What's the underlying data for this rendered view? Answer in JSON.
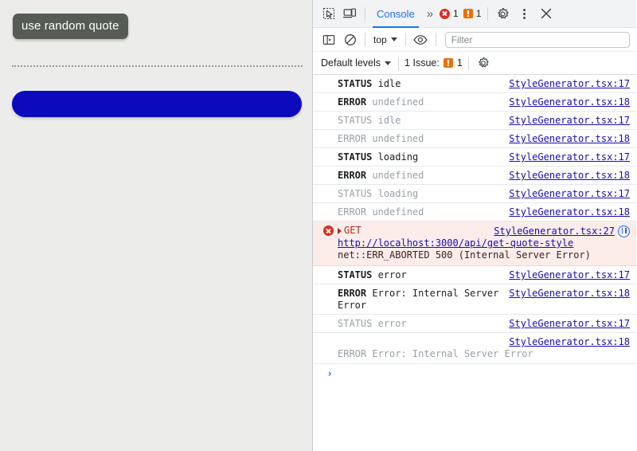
{
  "page": {
    "tooltip_label": "use random quote",
    "button_label": "",
    "button_color": "#0b0bbd",
    "background_color": "#ececeb",
    "tooltip_color": "#565b53"
  },
  "devtools": {
    "tabs": {
      "inspect_icon": "inspect-element-icon",
      "device_icon": "device-toolbar-icon",
      "active_tab": "Console",
      "more_tabs": "»",
      "error_count": "1",
      "warning_count": "1",
      "settings_icon": "gear-icon",
      "kebab_icon": "more-options-icon",
      "close_icon": "close-icon"
    },
    "toolbar": {
      "sidebar_icon": "console-sidebar-icon",
      "clear_icon": "clear-console-icon",
      "context": "top",
      "eye_icon": "live-expression-icon",
      "filter_placeholder": "Filter",
      "filter_value": ""
    },
    "levels": {
      "levels_label": "Default levels",
      "issues_label": "1 Issue:",
      "issues_count": "1",
      "issues_settings_icon": "gear-icon"
    },
    "messages": [
      {
        "kind": "log",
        "dimmed": false,
        "label": "STATUS",
        "value": "idle",
        "value_dim": false,
        "source": "StyleGenerator.tsx:17"
      },
      {
        "kind": "log",
        "dimmed": false,
        "label": "ERROR",
        "value": "undefined",
        "value_dim": true,
        "source": "StyleGenerator.tsx:18"
      },
      {
        "kind": "log",
        "dimmed": true,
        "label": "STATUS",
        "value": "idle",
        "value_dim": false,
        "source": "StyleGenerator.tsx:17"
      },
      {
        "kind": "log",
        "dimmed": true,
        "label": "ERROR",
        "value": "undefined",
        "value_dim": false,
        "source": "StyleGenerator.tsx:18"
      },
      {
        "kind": "log",
        "dimmed": false,
        "label": "STATUS",
        "value": "loading",
        "value_dim": false,
        "source": "StyleGenerator.tsx:17"
      },
      {
        "kind": "log",
        "dimmed": false,
        "label": "ERROR",
        "value": "undefined",
        "value_dim": true,
        "source": "StyleGenerator.tsx:18"
      },
      {
        "kind": "log",
        "dimmed": true,
        "label": "STATUS",
        "value": "loading",
        "value_dim": false,
        "source": "StyleGenerator.tsx:17"
      },
      {
        "kind": "log",
        "dimmed": true,
        "label": "ERROR",
        "value": "undefined",
        "value_dim": false,
        "source": "StyleGenerator.tsx:18"
      },
      {
        "kind": "network-error",
        "method": "GET",
        "url": "http://localhost:3000/api/get-quote-style",
        "detail": "net::ERR_ABORTED 500 (Internal Server Error)",
        "source": "StyleGenerator.tsx:27",
        "network_icon": "network-request-icon",
        "error_icon": "error-circle-icon",
        "expand_icon": "expand-triangle-icon"
      },
      {
        "kind": "log",
        "dimmed": false,
        "label": "STATUS",
        "value": "error",
        "value_dim": false,
        "source": "StyleGenerator.tsx:17"
      },
      {
        "kind": "log",
        "dimmed": false,
        "label": "ERROR",
        "value": "Error: Internal Server Error",
        "value_dim": false,
        "source": "StyleGenerator.tsx:18"
      },
      {
        "kind": "log",
        "dimmed": true,
        "label": "STATUS",
        "value": "error",
        "value_dim": false,
        "source": "StyleGenerator.tsx:17"
      },
      {
        "kind": "wrapped",
        "dimmed": true,
        "text": "ERROR Error: Internal Server Error",
        "source": "StyleGenerator.tsx:18"
      }
    ],
    "prompt": {
      "caret": "›",
      "value": ""
    }
  }
}
